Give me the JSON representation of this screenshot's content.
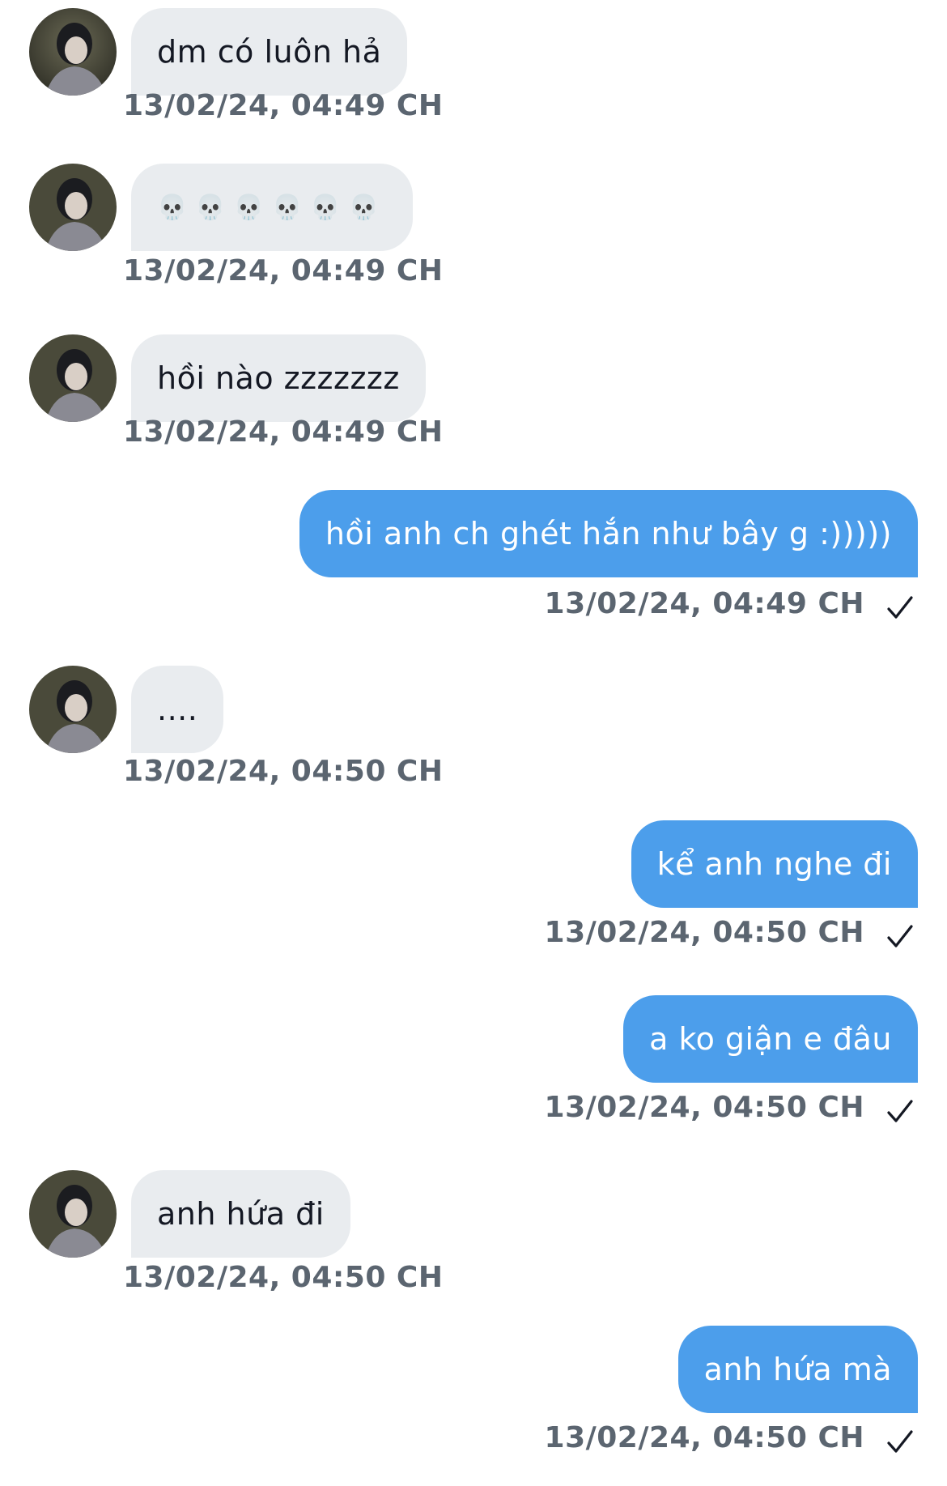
{
  "messages": [
    {
      "direction": "in",
      "text": "dm có luôn hả",
      "time": "13/02/24, 04:49 CH"
    },
    {
      "direction": "in",
      "text": "💀💀💀💀💀💀",
      "time": "13/02/24, 04:49 CH"
    },
    {
      "direction": "in",
      "text": "hồi nào zzzzzzz",
      "time": "13/02/24, 04:49 CH"
    },
    {
      "direction": "out",
      "text": "hồi anh ch ghét hắn như bây g :)))))",
      "time": "13/02/24, 04:49 CH",
      "status": "sent"
    },
    {
      "direction": "in",
      "text": "....",
      "time": "13/02/24, 04:50 CH"
    },
    {
      "direction": "out",
      "text": "kể anh nghe đi",
      "time": "13/02/24, 04:50 CH",
      "status": "sent"
    },
    {
      "direction": "out",
      "text": "a ko giận e đâu",
      "time": "13/02/24, 04:50 CH",
      "status": "sent"
    },
    {
      "direction": "in",
      "text": "anh hứa đi",
      "time": "13/02/24, 04:50 CH"
    },
    {
      "direction": "out",
      "text": "anh hứa mà",
      "time": "13/02/24, 04:50 CH",
      "status": "sent"
    }
  ],
  "icons": {
    "sent_check": "check-icon",
    "avatar": "contact-avatar"
  },
  "colors": {
    "incoming_bubble": "#e9ecef",
    "outgoing_bubble": "#4c9eeb",
    "timestamp": "#5b6570",
    "background": "#ffffff"
  }
}
